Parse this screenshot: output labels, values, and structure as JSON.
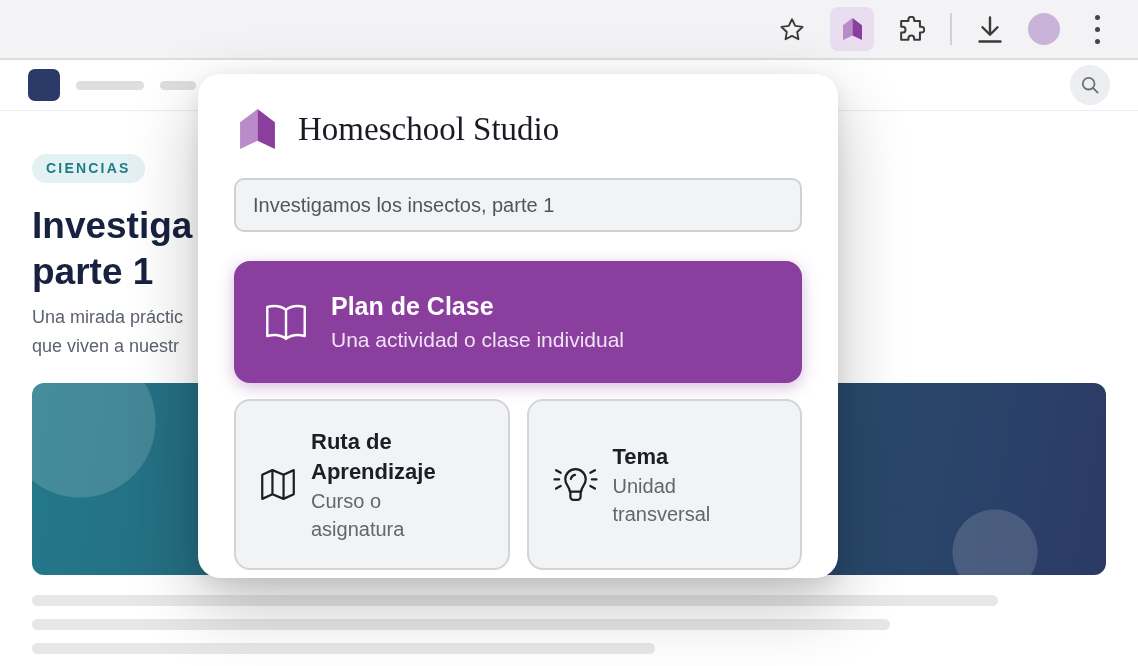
{
  "toolbar": {
    "extension_button": {
      "selected": true
    }
  },
  "site": {
    "category_tag": "CIENCIAS",
    "title_lines": [
      "Investiga",
      "parte 1"
    ],
    "description_lines": [
      "Una mirada práctic",
      "que viven a nuestr"
    ]
  },
  "popup": {
    "brand": "Homeschool Studio",
    "title_field": {
      "value": "Investigamos los insectos, parte 1"
    },
    "options": [
      {
        "kind": "wide",
        "title": "Plan de Clase",
        "subtitle": "Una actividad o clase individual",
        "selected": true
      },
      {
        "kind": "tile",
        "title": "Ruta de Aprendizaje",
        "subtitle": "Curso o asignatura",
        "selected": false
      },
      {
        "kind": "tile",
        "title": "Tema",
        "subtitle": "Unidad transversal",
        "selected": false
      }
    ]
  }
}
